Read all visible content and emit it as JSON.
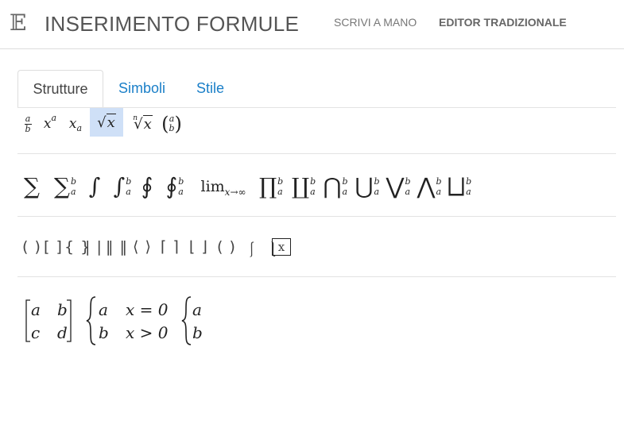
{
  "header": {
    "logo": "𝔼",
    "title": "INSERIMENTO FORMULE",
    "nav": {
      "handwrite": "SCRIVI A MANO",
      "editor": "EDITOR TRADIZIONALE"
    }
  },
  "tabs": {
    "structures": "Strutture",
    "symbols": "Simboli",
    "style": "Stile"
  },
  "row1": {
    "frac_num": "a",
    "frac_den": "b",
    "sup_base": "x",
    "sup_exp": "a",
    "sub_base": "x",
    "sub_idx": "a",
    "sqrt_arg": "x",
    "nroot_idx": "n",
    "nroot_arg": "x",
    "binom_top": "a",
    "binom_bot": "b"
  },
  "row2": {
    "sum": "∑",
    "sum_lim": "∑",
    "int": "∫",
    "int_lim": "∫",
    "oint": "∮",
    "oint_lim": "∮",
    "lim": "lim",
    "lim_sub": "x→∞",
    "prod": "∏",
    "coprod": "∐",
    "cap": "⋂",
    "cup": "⋃",
    "vee": "⋁",
    "wedge": "⋀",
    "sqcup": "⨆",
    "lower": "a",
    "upper": "b"
  },
  "row3": {
    "paren": "( )",
    "bracket": "[ ]",
    "brace": "{ }",
    "abs": "| |",
    "norm": "‖ ‖",
    "angle": "⟨ ⟩",
    "ceil": "⌈ ⌉",
    "floor": "⌊ ⌋",
    "group": "( )",
    "moustache": "⎰ ⎱",
    "boxed": "x"
  },
  "row4": {
    "matrix": {
      "a": "a",
      "b": "b",
      "c": "c",
      "d": "d"
    },
    "cases": {
      "r1c1": "a",
      "r1c2": "x = 0",
      "r2c1": "b",
      "r2c2": "x > 0"
    },
    "cases_simple": {
      "r1": "a",
      "r2": "b"
    }
  }
}
